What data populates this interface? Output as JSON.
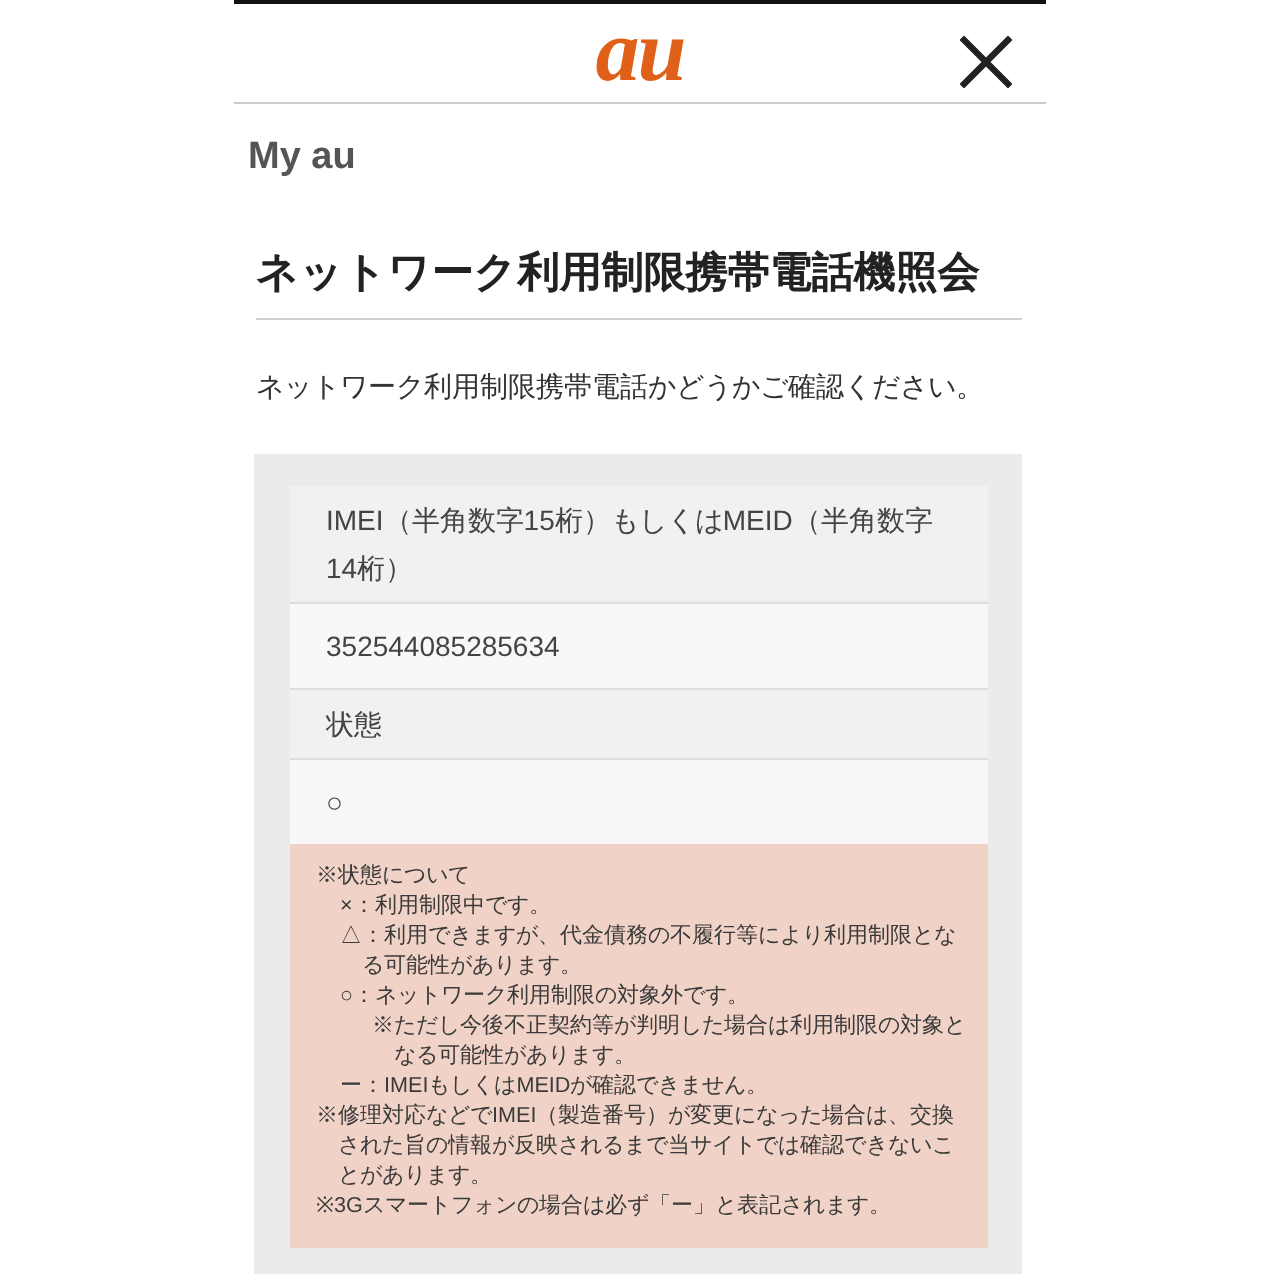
{
  "header": {
    "logo": "au"
  },
  "breadcrumb": "My au",
  "title": "ネットワーク利用制限携帯電話機照会",
  "instruction": "ネットワーク利用制限携帯電話かどうかご確認ください。",
  "result_table": {
    "rows": [
      {
        "kind": "label",
        "text": "IMEI（半角数字15桁）もしくはMEID（半角数字14桁）"
      },
      {
        "kind": "value",
        "text": "352544085285634"
      },
      {
        "kind": "label",
        "text": "状態"
      },
      {
        "kind": "value",
        "text": "○"
      }
    ]
  },
  "notes": [
    {
      "text": "※状態について",
      "children": [
        {
          "text": "×：利用制限中です。"
        },
        {
          "text": "△：利用できますが、代金債務の不履行等により利用制限となる可能性があります。"
        },
        {
          "text": "○：ネットワーク利用制限の対象外です。",
          "children": [
            {
              "text": "※ただし今後不正契約等が判明した場合は利用制限の対象となる可能性があります。"
            }
          ]
        },
        {
          "text": "ー：IMEIもしくはMEIDが確認できません。"
        }
      ]
    },
    {
      "text": "※修理対応などでIMEI（製造番号）が変更になった場合は、交換された旨の情報が反映されるまで当サイトでは確認できないことがあります。"
    },
    {
      "text": "※3Gスマートフォンの場合は必ず「ー」と表記されます。"
    }
  ]
}
